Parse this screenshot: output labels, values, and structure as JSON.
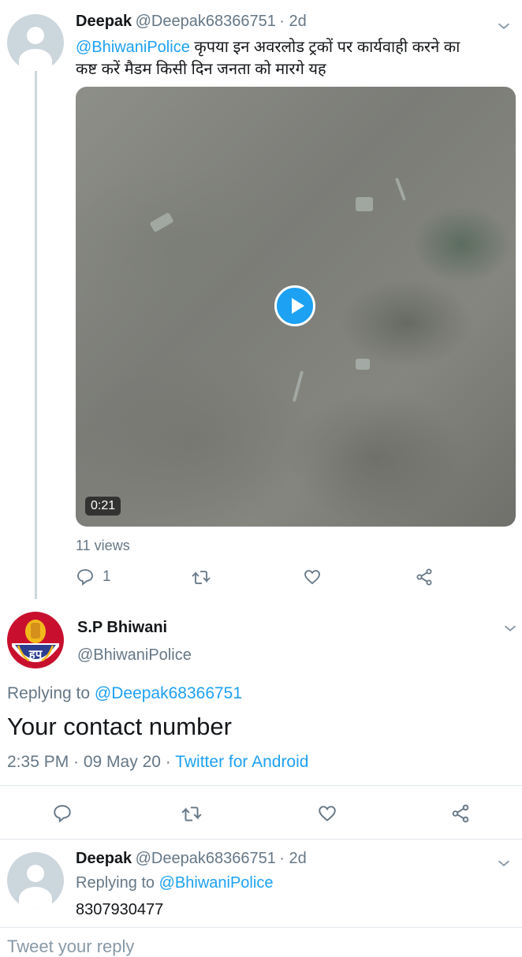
{
  "tweet1": {
    "name": "Deepak",
    "handle": "@Deepak68366751",
    "time": "· 2d",
    "mention": "@BhiwaniPolice",
    "text_line1": " कृपया इन अवरलोड ट्रकों पर कार्यवाही करने का",
    "text_line2": "कष्ट करें मैडम किसी दिन जनता को मारगे यह",
    "video_duration": "0:21",
    "views": "11 views",
    "reply_count": "1"
  },
  "main_tweet": {
    "name": "S.P Bhiwani",
    "handle": "@BhiwaniPolice",
    "replying_label": "Replying to ",
    "replying_to": "@Deepak68366751",
    "text": "Your contact number",
    "timestamp": "2:35 PM · 09 May 20 · ",
    "source": "Twitter for Android",
    "badge_text": "हप"
  },
  "tweet3": {
    "name": "Deepak",
    "handle": "@Deepak68366751",
    "time": "· 2d",
    "replying_label": "Replying to ",
    "replying_to": "@BhiwaniPolice",
    "text": "8307930477"
  },
  "composer": {
    "placeholder": "Tweet your reply"
  },
  "colors": {
    "accent": "#1da1f2",
    "muted": "#657786",
    "text": "#14171a"
  }
}
